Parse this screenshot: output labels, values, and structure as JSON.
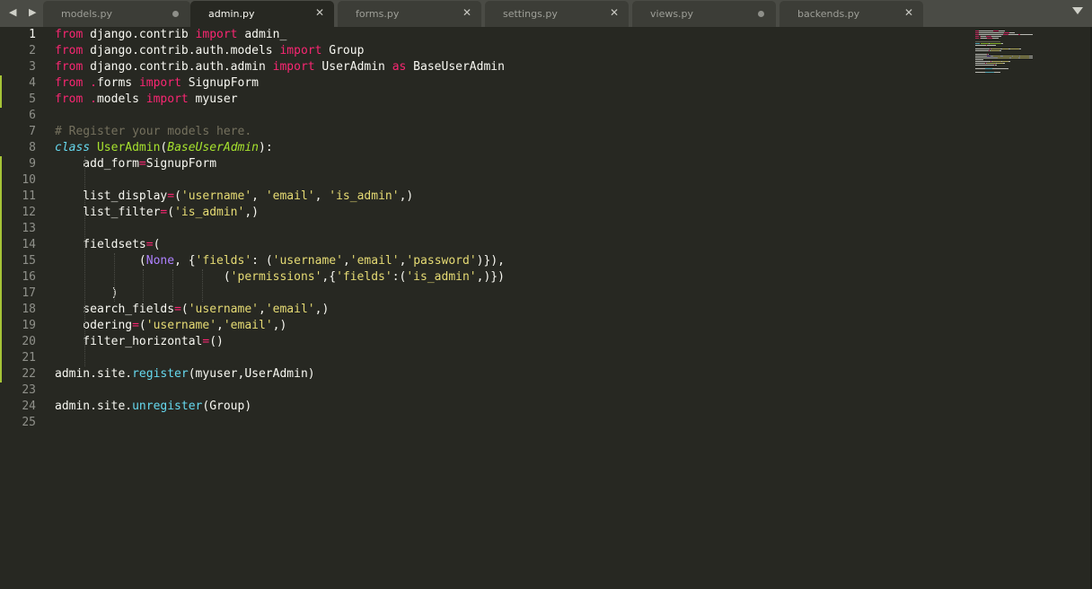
{
  "tabs": [
    {
      "label": "models.py",
      "state": "dirty"
    },
    {
      "label": "admin.py",
      "state": "active"
    },
    {
      "label": "forms.py",
      "state": "close"
    },
    {
      "label": "settings.py",
      "state": "close"
    },
    {
      "label": "views.py",
      "state": "dirty"
    },
    {
      "label": "backends.py",
      "state": "close"
    }
  ],
  "icons": {
    "nav_arrows": "◀ ▶",
    "close": "✕",
    "menu": "chevron-down-icon"
  },
  "line_numbers": [
    "1",
    "2",
    "3",
    "4",
    "5",
    "6",
    "7",
    "8",
    "9",
    "10",
    "11",
    "12",
    "13",
    "14",
    "15",
    "16",
    "17",
    "18",
    "19",
    "20",
    "21",
    "22",
    "23",
    "24",
    "25"
  ],
  "code_lines": [
    [
      [
        "k",
        "from"
      ],
      [
        "p",
        " django.contrib "
      ],
      [
        "k",
        "import"
      ],
      [
        "p",
        " admin"
      ],
      [
        "cursor",
        "_"
      ]
    ],
    [
      [
        "k",
        "from"
      ],
      [
        "p",
        " django.contrib.auth.models "
      ],
      [
        "k",
        "import"
      ],
      [
        "p",
        " Group"
      ]
    ],
    [
      [
        "k",
        "from"
      ],
      [
        "p",
        " django.contrib.auth.admin "
      ],
      [
        "k",
        "import"
      ],
      [
        "p",
        " UserAdmin "
      ],
      [
        "k",
        "as"
      ],
      [
        "p",
        " BaseUserAdmin"
      ]
    ],
    [
      [
        "k",
        "from"
      ],
      [
        "p",
        " "
      ],
      [
        "k",
        "."
      ],
      [
        "p",
        "forms "
      ],
      [
        "k",
        "import"
      ],
      [
        "p",
        " SignupForm"
      ]
    ],
    [
      [
        "k",
        "from"
      ],
      [
        "p",
        " "
      ],
      [
        "k",
        "."
      ],
      [
        "p",
        "models "
      ],
      [
        "k",
        "import"
      ],
      [
        "p",
        " myuser"
      ]
    ],
    [],
    [
      [
        "c",
        "# Register your models here."
      ]
    ],
    [
      [
        "it",
        "class"
      ],
      [
        "p",
        " "
      ],
      [
        "cls",
        "UserAdmin"
      ],
      [
        "p",
        "("
      ],
      [
        "inh",
        "BaseUserAdmin"
      ],
      [
        "p",
        "):"
      ]
    ],
    [
      [
        "p",
        "    add_form"
      ],
      [
        "k",
        "="
      ],
      [
        "p",
        "SignupForm"
      ]
    ],
    [],
    [
      [
        "p",
        "    list_display"
      ],
      [
        "k",
        "="
      ],
      [
        "p",
        "("
      ],
      [
        "s",
        "'username'"
      ],
      [
        "p",
        ", "
      ],
      [
        "s",
        "'email'"
      ],
      [
        "p",
        ", "
      ],
      [
        "s",
        "'is_admin'"
      ],
      [
        "p",
        ",)"
      ]
    ],
    [
      [
        "p",
        "    list_filter"
      ],
      [
        "k",
        "="
      ],
      [
        "p",
        "("
      ],
      [
        "s",
        "'is_admin'"
      ],
      [
        "p",
        ",)"
      ]
    ],
    [],
    [
      [
        "p",
        "    fieldsets"
      ],
      [
        "k",
        "="
      ],
      [
        "p",
        "("
      ]
    ],
    [
      [
        "p",
        "            ("
      ],
      [
        "n",
        "None"
      ],
      [
        "p",
        ", {"
      ],
      [
        "s",
        "'fields'"
      ],
      [
        "p",
        ": ("
      ],
      [
        "s",
        "'username'"
      ],
      [
        "p",
        ","
      ],
      [
        "s",
        "'email'"
      ],
      [
        "p",
        ","
      ],
      [
        "s",
        "'password'"
      ],
      [
        "p",
        ")}),"
      ]
    ],
    [
      [
        "p",
        "                        ("
      ],
      [
        "s",
        "'permissions'"
      ],
      [
        "p",
        ",{"
      ],
      [
        "s",
        "'fields'"
      ],
      [
        "p",
        ":("
      ],
      [
        "s",
        "'is_admin'"
      ],
      [
        "p",
        ",)})"
      ]
    ],
    [
      [
        "p",
        "        )"
      ]
    ],
    [
      [
        "p",
        "    search_fields"
      ],
      [
        "k",
        "="
      ],
      [
        "p",
        "("
      ],
      [
        "s",
        "'username'"
      ],
      [
        "p",
        ","
      ],
      [
        "s",
        "'email'"
      ],
      [
        "p",
        ",)"
      ]
    ],
    [
      [
        "p",
        "    odering"
      ],
      [
        "k",
        "="
      ],
      [
        "p",
        "("
      ],
      [
        "s",
        "'username'"
      ],
      [
        "p",
        ","
      ],
      [
        "s",
        "'email'"
      ],
      [
        "p",
        ",)"
      ]
    ],
    [
      [
        "p",
        "    filter_horizontal"
      ],
      [
        "k",
        "="
      ],
      [
        "p",
        "()"
      ]
    ],
    [],
    [
      [
        "p",
        "admin.site."
      ],
      [
        "f",
        "register"
      ],
      [
        "p",
        "(myuser,UserAdmin)"
      ]
    ],
    [],
    [
      [
        "p",
        "admin.site."
      ],
      [
        "f",
        "unregister"
      ],
      [
        "p",
        "(Group)"
      ]
    ],
    []
  ],
  "colors": {
    "background": "#272822",
    "tab_bar": "#4a4b45",
    "keyword": "#f92672",
    "string": "#e6db74",
    "comment": "#75715e",
    "function": "#66d9ef",
    "class_name": "#a6e22e",
    "constant": "#ae81ff",
    "plain": "#f8f8f2",
    "modified_marker": "#a6c437"
  }
}
